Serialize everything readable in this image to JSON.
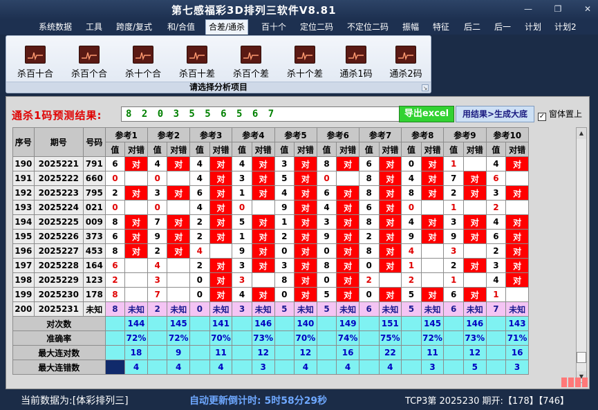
{
  "window": {
    "title": "第七感福彩3D排列三软件V8.81",
    "min": "—",
    "max": "❐",
    "close": "✕"
  },
  "menu": [
    "系统数据",
    "工具",
    "跨度/复式",
    "和/合值",
    "合差/通杀",
    "百十个",
    "定位二码",
    "不定位二码",
    "振幅",
    "特征",
    "后二",
    "后一",
    "计划",
    "计划2"
  ],
  "menu_active": "合差/通杀",
  "ribbon": {
    "buttons": [
      "杀百十合",
      "杀百个合",
      "杀十个合",
      "杀百十差",
      "杀百个差",
      "杀十个差",
      "通杀1码",
      "通杀2码"
    ],
    "caption": "请选择分析项目",
    "corner": "↘"
  },
  "prediction": {
    "label": "通杀1码预测结果:",
    "value": "8 2 0 3 5 5 6 5 6 7",
    "excel_button": "导出excel",
    "generate_button": "用结果>生成大底",
    "checkbox_label": "窗体置上",
    "checkbox_mark": "✓"
  },
  "table": {
    "headers": {
      "seq": "序号",
      "period": "期号",
      "number": "号码",
      "refs": [
        "参考1",
        "参考2",
        "参考3",
        "参考4",
        "参考5",
        "参考6",
        "参考7",
        "参考8",
        "参考9",
        "参考10"
      ],
      "value": "值",
      "result": "对错"
    },
    "mark": "对",
    "unknown_label": "未知",
    "rows": [
      {
        "seq": "190",
        "period": "2025221",
        "num": "791",
        "cells": [
          [
            "6",
            true
          ],
          [
            "4",
            true
          ],
          [
            "4",
            true
          ],
          [
            "4",
            true
          ],
          [
            "3",
            true
          ],
          [
            "8",
            true
          ],
          [
            "6",
            true
          ],
          [
            "0",
            true
          ],
          [
            "1",
            false
          ],
          [
            "4",
            true
          ]
        ]
      },
      {
        "seq": "191",
        "period": "2025222",
        "num": "660",
        "cells": [
          [
            "0",
            false
          ],
          [
            "0",
            false
          ],
          [
            "4",
            true
          ],
          [
            "3",
            true
          ],
          [
            "5",
            true
          ],
          [
            "0",
            false
          ],
          [
            "8",
            true
          ],
          [
            "4",
            true
          ],
          [
            "7",
            true
          ],
          [
            "6",
            false
          ]
        ]
      },
      {
        "seq": "192",
        "period": "2025223",
        "num": "795",
        "cells": [
          [
            "2",
            true
          ],
          [
            "3",
            true
          ],
          [
            "6",
            true
          ],
          [
            "1",
            true
          ],
          [
            "4",
            true
          ],
          [
            "6",
            true
          ],
          [
            "8",
            true
          ],
          [
            "8",
            true
          ],
          [
            "2",
            true
          ],
          [
            "3",
            true
          ]
        ]
      },
      {
        "seq": "193",
        "period": "2025224",
        "num": "021",
        "cells": [
          [
            "0",
            false
          ],
          [
            "0",
            false
          ],
          [
            "4",
            true
          ],
          [
            "0",
            false
          ],
          [
            "9",
            true
          ],
          [
            "4",
            true
          ],
          [
            "6",
            true
          ],
          [
            "0",
            false
          ],
          [
            "1",
            false
          ],
          [
            "2",
            false
          ]
        ]
      },
      {
        "seq": "194",
        "period": "2025225",
        "num": "009",
        "cells": [
          [
            "8",
            true
          ],
          [
            "7",
            true
          ],
          [
            "2",
            true
          ],
          [
            "5",
            true
          ],
          [
            "1",
            true
          ],
          [
            "3",
            true
          ],
          [
            "8",
            true
          ],
          [
            "4",
            true
          ],
          [
            "3",
            true
          ],
          [
            "4",
            true
          ]
        ]
      },
      {
        "seq": "195",
        "period": "2025226",
        "num": "373",
        "cells": [
          [
            "6",
            true
          ],
          [
            "9",
            true
          ],
          [
            "2",
            true
          ],
          [
            "1",
            true
          ],
          [
            "2",
            true
          ],
          [
            "9",
            true
          ],
          [
            "2",
            true
          ],
          [
            "9",
            true
          ],
          [
            "9",
            true
          ],
          [
            "6",
            true
          ]
        ]
      },
      {
        "seq": "196",
        "period": "2025227",
        "num": "453",
        "cells": [
          [
            "8",
            true
          ],
          [
            "2",
            true
          ],
          [
            "4",
            false
          ],
          [
            "9",
            true
          ],
          [
            "0",
            true
          ],
          [
            "0",
            true
          ],
          [
            "8",
            true
          ],
          [
            "4",
            false
          ],
          [
            "3",
            false
          ],
          [
            "2",
            true
          ]
        ]
      },
      {
        "seq": "197",
        "period": "2025228",
        "num": "164",
        "cells": [
          [
            "6",
            false
          ],
          [
            "4",
            false
          ],
          [
            "2",
            true
          ],
          [
            "3",
            true
          ],
          [
            "3",
            true
          ],
          [
            "8",
            true
          ],
          [
            "0",
            true
          ],
          [
            "1",
            false
          ],
          [
            "2",
            true
          ],
          [
            "3",
            true
          ]
        ]
      },
      {
        "seq": "198",
        "period": "2025229",
        "num": "123",
        "cells": [
          [
            "2",
            false
          ],
          [
            "3",
            false
          ],
          [
            "0",
            true
          ],
          [
            "3",
            false
          ],
          [
            "8",
            true
          ],
          [
            "0",
            true
          ],
          [
            "2",
            false
          ],
          [
            "2",
            false
          ],
          [
            "1",
            false
          ],
          [
            "4",
            true
          ]
        ]
      },
      {
        "seq": "199",
        "period": "2025230",
        "num": "178",
        "cells": [
          [
            "8",
            false
          ],
          [
            "7",
            false
          ],
          [
            "0",
            true
          ],
          [
            "4",
            true
          ],
          [
            "0",
            true
          ],
          [
            "5",
            true
          ],
          [
            "0",
            true
          ],
          [
            "5",
            true
          ],
          [
            "6",
            true
          ],
          [
            "1",
            false
          ]
        ]
      }
    ],
    "unknown_row": {
      "seq": "200",
      "period": "2025231",
      "num": "未知",
      "values": [
        "8",
        "2",
        "0",
        "3",
        "5",
        "5",
        "6",
        "5",
        "6",
        "7"
      ]
    },
    "stats": [
      {
        "label": "对次数",
        "values": [
          "144",
          "145",
          "141",
          "146",
          "140",
          "149",
          "151",
          "145",
          "146",
          "143"
        ]
      },
      {
        "label": "准确率",
        "values": [
          "72%",
          "72%",
          "70%",
          "73%",
          "70%",
          "74%",
          "75%",
          "72%",
          "73%",
          "71%"
        ]
      },
      {
        "label": "最大连对数",
        "values": [
          "18",
          "9",
          "11",
          "12",
          "12",
          "16",
          "22",
          "11",
          "12",
          "16"
        ]
      },
      {
        "label": "最大连错数",
        "values": [
          "4",
          "4",
          "4",
          "3",
          "4",
          "4",
          "4",
          "3",
          "5",
          "3"
        ]
      }
    ]
  },
  "status": {
    "data_label": "当前数据为:[体彩排列三]",
    "timer": "自动更新倒计时:  5时58分29秒",
    "tcp": "TCP3第 2025230 期开:【178】【746】"
  }
}
